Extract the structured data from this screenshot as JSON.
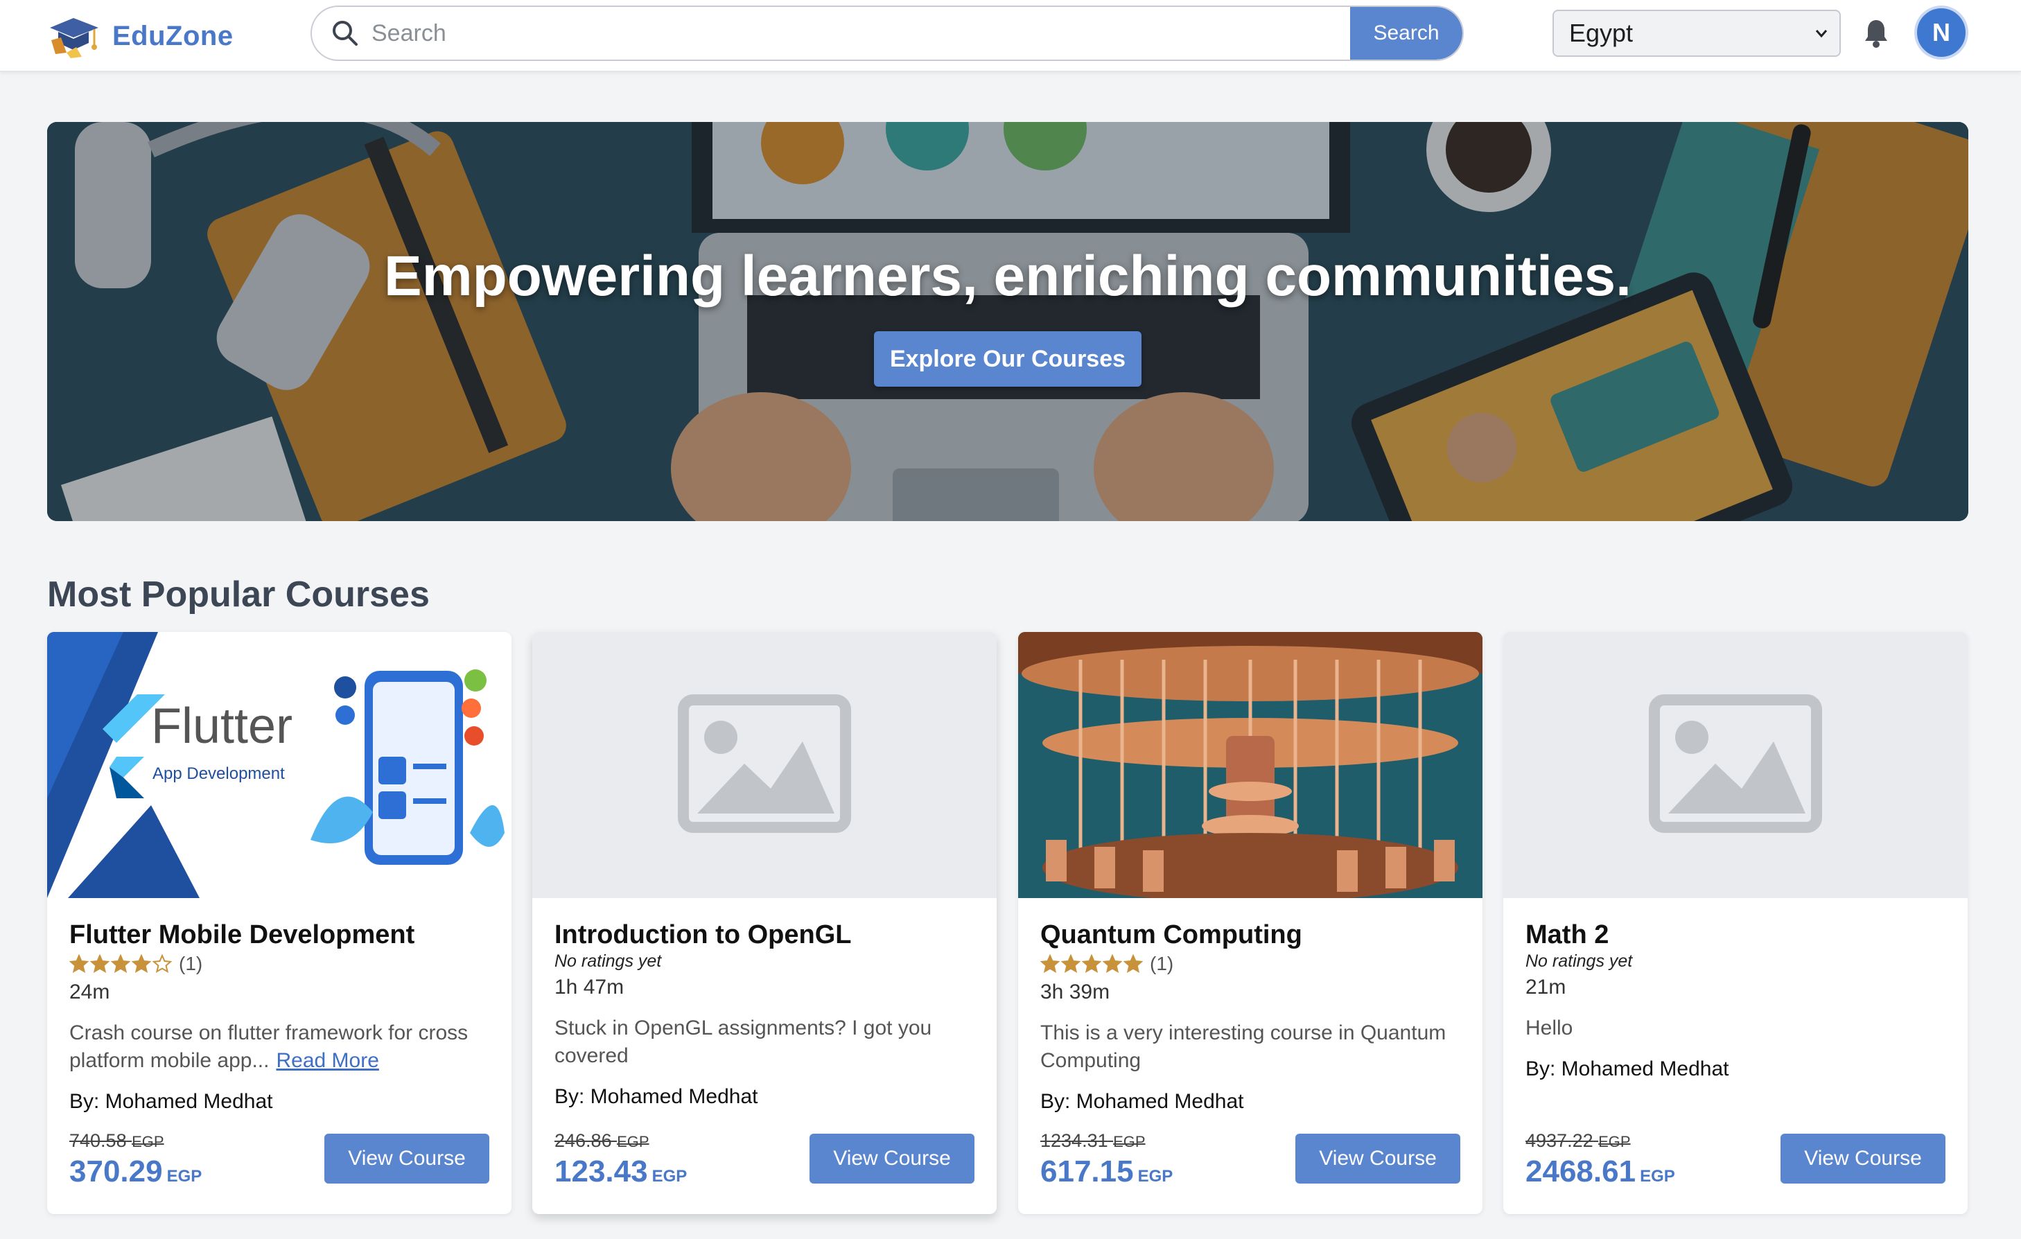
{
  "header": {
    "logo_text": "EduZone",
    "search_placeholder": "Search",
    "search_button": "Search",
    "country_selected": "Egypt",
    "avatar_initial": "N"
  },
  "hero": {
    "title": "Empowering learners, enriching communities.",
    "button": "Explore Our Courses"
  },
  "section": {
    "title": "Most Popular Courses"
  },
  "courses": [
    {
      "title": "Flutter Mobile Development",
      "thumbnail_brand": "Flutter",
      "thumbnail_subtitle": "App Development",
      "rating_stars": 4,
      "rating_count": "(1)",
      "duration": "24m",
      "description": "Crash course on flutter framework for cross platform mobile app...",
      "read_more": "Read More",
      "author": "By: Mohamed Medhat",
      "old_price": "740.58",
      "new_price": "370.29",
      "currency": "EGP",
      "button": "View Course"
    },
    {
      "title": "Introduction to OpenGL",
      "rating_text": "No ratings yet",
      "duration": "1h 47m",
      "description": "Stuck in OpenGL assignments? I got you covered",
      "author": "By: Mohamed Medhat",
      "old_price": "246.86",
      "new_price": "123.43",
      "currency": "EGP",
      "button": "View Course"
    },
    {
      "title": "Quantum Computing",
      "rating_stars": 5,
      "rating_count": "(1)",
      "duration": "3h 39m",
      "description": "This is a very interesting course in Quantum Computing",
      "author": "By: Mohamed Medhat",
      "old_price": "1234.31",
      "new_price": "617.15",
      "currency": "EGP",
      "button": "View Course"
    },
    {
      "title": "Math 2",
      "rating_text": "No ratings yet",
      "duration": "21m",
      "description": "Hello",
      "author": "By: Mohamed Medhat",
      "old_price": "4937.22",
      "new_price": "2468.61",
      "currency": "EGP",
      "button": "View Course"
    }
  ],
  "colors": {
    "accent": "#5a85cf",
    "brand": "#4a78c9",
    "star": "#c8923a",
    "placeholder_bg": "#e9ebee"
  },
  "icons": {
    "logo": "graduation-cap-icon",
    "search": "search-icon",
    "dropdown": "chevron-down-icon",
    "notifications": "bell-icon",
    "image_placeholder": "image-placeholder-icon",
    "star": "star-icon"
  }
}
